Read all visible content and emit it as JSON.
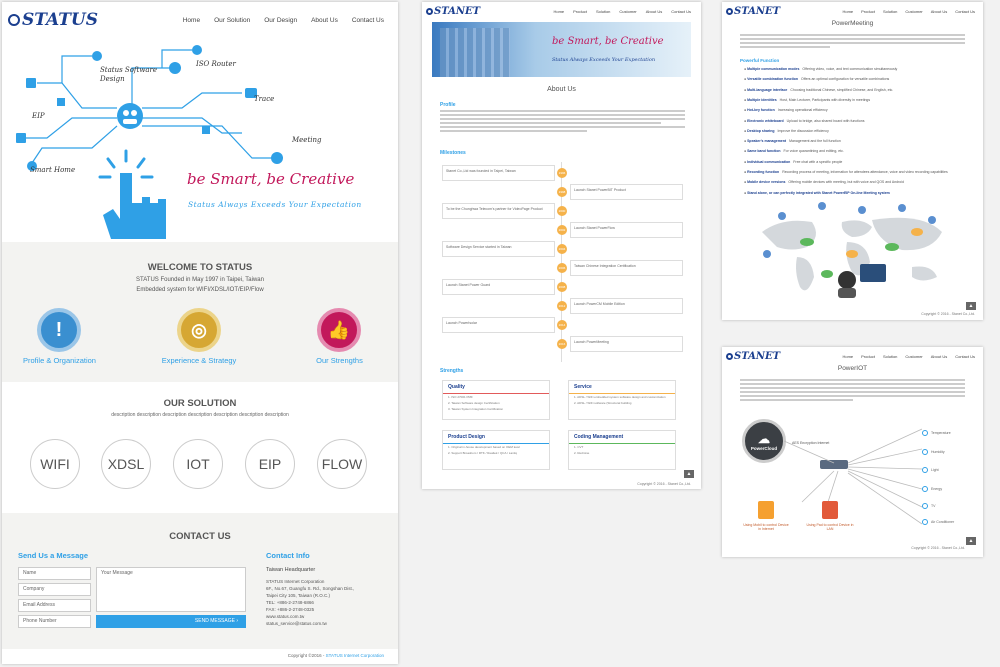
{
  "status_site": {
    "logo": "STATUS",
    "nav": [
      "Home",
      "Our Solution",
      "Our Design",
      "About Us",
      "Contact Us"
    ],
    "diagram_labels": [
      "Status Software Design",
      "ISO Router",
      "Trace",
      "EIP",
      "Meeting",
      "Smart Home"
    ],
    "slogan": "be Smart, be Creative",
    "sub_slogan": "Status Always Exceeds Your Expectation",
    "welcome_title": "WELCOME TO STATUS",
    "welcome_text1": "STATUS Founded in May 1997 in Taipei, Taiwan",
    "welcome_text2": "Embedded system for WIFI/XDSL/IOT/EIP/Flow",
    "features": [
      "Profile & Organization",
      "Experience & Strategy",
      "Our Strengths"
    ],
    "solution_title": "OUR SOLUTION",
    "solution_desc": "description description description description description description description",
    "solutions": [
      "WIFI",
      "XDSL",
      "IOT",
      "EIP",
      "FLOW"
    ],
    "contact_title": "CONTACT US",
    "send_title": "Send Us a Message",
    "form_placeholders": [
      "Name",
      "Company",
      "Email Address",
      "Phone Number"
    ],
    "message_placeholder": "Your Message",
    "send_button": "SEND MESSAGE",
    "info_title": "Contact Info",
    "hq_title": "Taiwan Headquarter",
    "hq_lines": [
      "STATUS Internet Corporation",
      "6F., No.67, Guangfu S. Rd., Songshan Dist.,",
      "Taipei City 105, Taiwan (R.O.C.)",
      "TEL: +886-2-2748-6866",
      "FAX: +886-2-2748-0325",
      "www.status.com.tw",
      "status_service@status.com.tw"
    ],
    "footer_copy": "Copyright ©2016 - ",
    "footer_link": "STATUS Internet Corporation"
  },
  "about_page": {
    "logo": "STANET",
    "nav": [
      "Home",
      "Product",
      "Solution",
      "Customer",
      "About Us",
      "Contact Us"
    ],
    "banner_slogan": "be Smart, be Creative",
    "banner_sub": "Status Always Exceeds Your Expectation",
    "title": "About Us",
    "profile_heading": "Profile",
    "milestones_heading": "Milestones",
    "milestones": [
      {
        "year": "1996",
        "text": "Stanet Co.,Ltd was founded in Taipei, Taiwan",
        "side": "left"
      },
      {
        "year": "1998",
        "text": "Launch Stanet PowerBIT Product",
        "side": "right"
      },
      {
        "year": "2000",
        "text": "To be the Chunghwa Telecom's partner for VideoPage Product",
        "side": "left"
      },
      {
        "year": "2002",
        "text": "Launch Stanet PowerFlow",
        "side": "right"
      },
      {
        "year": "2004",
        "text": "Software Design Service started in Taiwan",
        "side": "left"
      },
      {
        "year": "2006",
        "text": "Taiwan Chinese Integration Certification",
        "side": "right"
      },
      {
        "year": "2008",
        "text": "Launch Stanet Power Guard",
        "side": "left"
      },
      {
        "year": "2012",
        "text": "Launch PowerCM Mobile Edition",
        "side": "right"
      },
      {
        "year": "2014",
        "text": "Launch PowerIsolar",
        "side": "left"
      },
      {
        "year": "2016",
        "text": "Launch PowerMeeting",
        "side": "right"
      }
    ],
    "strengths_heading": "Strengths",
    "strength_cards": [
      {
        "title": "Quality",
        "color": "#e25a5a",
        "items": [
          "1. ISO 27001 PMF",
          "2. Taiwan Software design Certification",
          "3. Taiwan System Integration Certification"
        ]
      },
      {
        "title": "Service",
        "color": "#f5b24a",
        "items": [
          "1. ADSL / WiFi embedded system software design and customization",
          "2. ADSL / WiFi software (Structural building"
        ]
      },
      {
        "title": "Product Design",
        "color": "#2fa0e6",
        "items": [
          "1. Original in-house development based on OEM level",
          "2. Support Broadcom / RTK / Realtek / QCA / Lantiq"
        ]
      },
      {
        "title": "Coding Management",
        "color": "#5cb85c",
        "items": [
          "1. CVT",
          "2. Redmine"
        ]
      }
    ],
    "footer": "Copyright © 2016 - Stanet Co.,Ltd."
  },
  "meeting_page": {
    "logo": "STANET",
    "nav": [
      "Home",
      "Product",
      "Solution",
      "Customer",
      "About Us",
      "Contact Us"
    ],
    "title": "PowerMeeting",
    "functions_heading": "Powerful Function",
    "functions": [
      {
        "name": "Multiple communication modes",
        "desc": "Offering video, voice, and text communication simultaneously"
      },
      {
        "name": "Versatile combination function",
        "desc": "Offers an optimal configuration for versatile combinations"
      },
      {
        "name": "Multi-language interface",
        "desc": "Choosing traditional Chinese, simplified Chinese, and English, etc."
      },
      {
        "name": "Multiple identities",
        "desc": "Host, Main Lecturer, Participants with diversity in meetings"
      },
      {
        "name": "Hot-key function",
        "desc": "Increasing operational efficiency"
      },
      {
        "name": "Electronic whiteboard",
        "desc": "Upload to bridge, also shared board with functions"
      },
      {
        "name": "Desktop sharing",
        "desc": "Improve the discussion efficiency"
      },
      {
        "name": "Speaker's management",
        "desc": "Management and the full function"
      },
      {
        "name": "Same band function",
        "desc": "For voice quarantining and editing, etc."
      },
      {
        "name": "Individual communication",
        "desc": "Free chat with a specific people"
      },
      {
        "name": "Recording function",
        "desc": "Recording process of meeting, information for attendees attendance, voice and video recording capabilities"
      },
      {
        "name": "Mobile device versions",
        "desc": "Offering mobile devices with meeting, but with voice and QOS and Android"
      },
      {
        "name": "Stand alone, or can perfectly integrated with Stanet PowerEIP On-line Meeting system",
        "desc": ""
      }
    ],
    "footer": "Copyright © 2016 - Stanet Co.,Ltd."
  },
  "iot_page": {
    "logo": "STANET",
    "nav": [
      "Home",
      "Product",
      "Solution",
      "Customer",
      "About Us",
      "Contact Us"
    ],
    "title": "PowerIOT",
    "cloud_label": "PowerCloud",
    "encryption_label": "AES Encryption Internet",
    "devices": [
      "Temperature",
      "Humidity",
      "Light",
      "Energy",
      "TV",
      "Air Conditioner"
    ],
    "mobile_label1": "Using Mobil to control Device in Internet",
    "mobile_label2": "Using Pad to control Device in LAN",
    "footer": "Copyright © 2016 - Stanet Co.,Ltd."
  },
  "colors": {
    "brand": "#1b3f8f",
    "accent": "#2fa0e6",
    "pink": "#c2185b",
    "orange": "#f5b24a"
  }
}
